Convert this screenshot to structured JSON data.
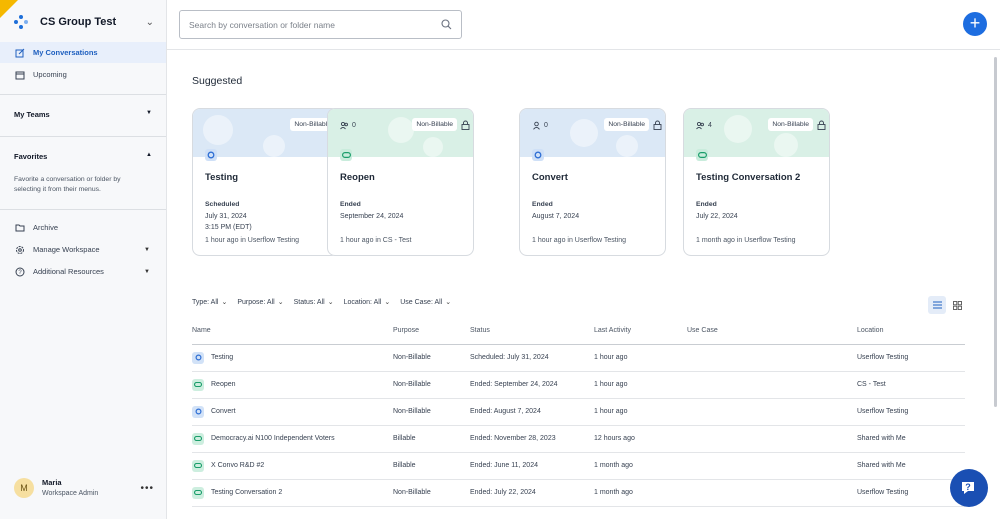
{
  "workspace": {
    "name": "CS Group Test"
  },
  "sidebar": {
    "my_conversations": "My Conversations",
    "upcoming": "Upcoming",
    "my_teams": "My Teams",
    "favorites": "Favorites",
    "favorites_hint": "Favorite a conversation or folder by selecting it from their menus.",
    "archive": "Archive",
    "manage_workspace": "Manage Workspace",
    "additional_resources": "Additional Resources"
  },
  "user": {
    "initial": "M",
    "name": "Maria",
    "role": "Workspace Admin"
  },
  "search": {
    "placeholder": "Search by conversation or folder name",
    "value": ""
  },
  "main": {
    "suggested_title": "Suggested"
  },
  "cards": [
    {
      "title": "Testing",
      "badge": "Non-Billable",
      "people": "",
      "status": "Scheduled",
      "date": "July 31, 2024",
      "time": "3:15 PM (EDT)",
      "footer": "1 hour ago in Userflow Testing",
      "type": "blue"
    },
    {
      "title": "Reopen",
      "badge": "Non-Billable",
      "people": "0",
      "status": "Ended",
      "date": "September 24, 2024",
      "time": "",
      "footer": "1 hour ago in CS - Test",
      "type": "green"
    },
    {
      "title": "Convert",
      "badge": "Non-Billable",
      "people": "0",
      "status": "Ended",
      "date": "August 7, 2024",
      "time": "",
      "footer": "1 hour ago in Userflow Testing",
      "type": "blue"
    },
    {
      "title": "Testing Conversation 2",
      "badge": "Non-Billable",
      "people": "4",
      "status": "Ended",
      "date": "July 22, 2024",
      "time": "",
      "footer": "1 month ago in Userflow Testing",
      "type": "green"
    }
  ],
  "filters": [
    "Type: All",
    "Purpose: All",
    "Status: All",
    "Location: All",
    "Use Case: All"
  ],
  "table": {
    "headers": [
      "Name",
      "Purpose",
      "Status",
      "Last Activity",
      "Use Case",
      "Location"
    ],
    "rows": [
      {
        "name": "Testing",
        "purpose": "Non-Billable",
        "status": "Scheduled: July 31, 2024",
        "activity": "1 hour ago",
        "use_case": "",
        "location": "Userflow Testing",
        "type": "blue"
      },
      {
        "name": "Reopen",
        "purpose": "Non-Billable",
        "status": "Ended: September 24, 2024",
        "activity": "1 hour ago",
        "use_case": "",
        "location": "CS - Test",
        "type": "green"
      },
      {
        "name": "Convert",
        "purpose": "Non-Billable",
        "status": "Ended: August 7, 2024",
        "activity": "1 hour ago",
        "use_case": "",
        "location": "Userflow Testing",
        "type": "blue"
      },
      {
        "name": "Democracy.ai N100 Independent Voters",
        "purpose": "Billable",
        "status": "Ended: November 28, 2023",
        "activity": "12 hours ago",
        "use_case": "",
        "location": "Shared with Me",
        "type": "green"
      },
      {
        "name": "X Convo R&D #2",
        "purpose": "Billable",
        "status": "Ended: June 11, 2024",
        "activity": "1 month ago",
        "use_case": "",
        "location": "Shared with Me",
        "type": "green"
      },
      {
        "name": "Testing Conversation 2",
        "purpose": "Non-Billable",
        "status": "Ended: July 22, 2024",
        "activity": "1 month ago",
        "use_case": "",
        "location": "Userflow Testing",
        "type": "green"
      }
    ]
  },
  "colors": {
    "accent": "#1d6de0",
    "card_blue": "#dbe8f6",
    "card_green": "#d9f0e6",
    "brand_corner": "#f5b800",
    "help": "#1a4fb3"
  },
  "icons": {
    "search": "search-icon",
    "add": "plus-icon",
    "help": "help-chat-icon"
  }
}
